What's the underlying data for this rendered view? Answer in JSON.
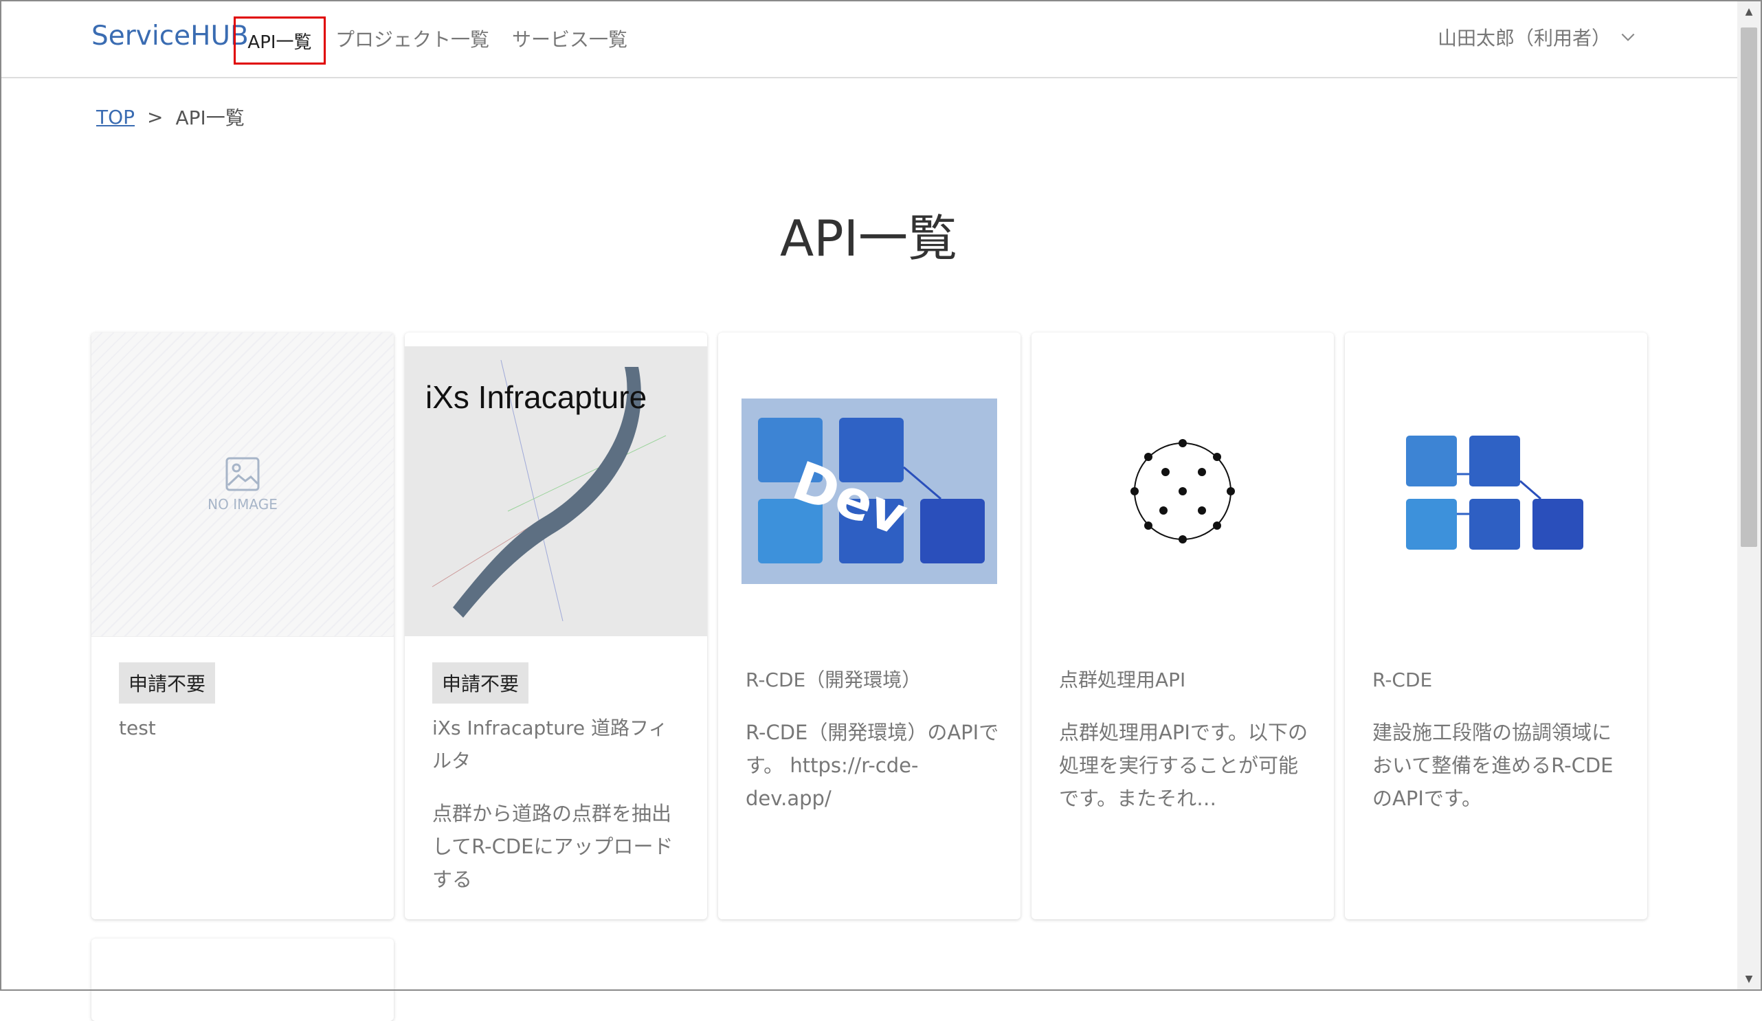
{
  "header": {
    "brand": "ServiceHUB",
    "nav": [
      {
        "label": "API一覧"
      },
      {
        "label": "プロジェクト一覧"
      },
      {
        "label": "サービス一覧"
      }
    ],
    "user": "山田太郎（利用者）"
  },
  "breadcrumb": {
    "home": "TOP",
    "separator": ">",
    "current": "API一覧"
  },
  "page_title": "API一覧",
  "cards": [
    {
      "badge": "申請不要",
      "name": "test",
      "description": "",
      "image_label": "NO IMAGE"
    },
    {
      "badge": "申請不要",
      "name": "iXs Infracapture 道路フィルタ",
      "description": "点群から道路の点群を抽出してR-CDEにアップロードする",
      "image_label": "iXs Infracapture"
    },
    {
      "badge": "",
      "name": "R-CDE（開発環境）",
      "description": "R-CDE（開発環境）のAPIです。 https://r-cde-dev.app/",
      "image_label": "Dev"
    },
    {
      "badge": "",
      "name": "点群処理用API",
      "description": "点群処理用APIです。以下の処理を実行することが可能です。またそれ…",
      "image_label": ""
    },
    {
      "badge": "",
      "name": "R-CDE",
      "description": "建設施工段階の協調領域において整備を進めるR-CDEのAPIです。",
      "image_label": ""
    }
  ],
  "colors": {
    "brand": "#3a6cb2",
    "highlight": "#e00000",
    "badge_bg": "#e3e3e3"
  }
}
